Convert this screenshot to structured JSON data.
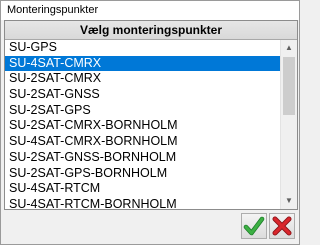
{
  "window": {
    "title": "Monteringspunkter"
  },
  "list": {
    "header": "Vælg monteringspunkter",
    "selected_index": 1,
    "items": [
      "SU-GPS",
      "SU-4SAT-CMRX",
      "SU-2SAT-CMRX",
      "SU-2SAT-GNSS",
      "SU-2SAT-GPS",
      "SU-2SAT-CMRX-BORNHOLM",
      "SU-4SAT-CMRX-BORNHOLM",
      "SU-2SAT-GNSS-BORNHOLM",
      "SU-2SAT-GPS-BORNHOLM",
      "SU-4SAT-RTCM",
      "SU-4SAT-RTCM-BORNHOLM"
    ]
  },
  "buttons": {
    "ok_icon": "green-check-icon",
    "cancel_icon": "red-x-icon",
    "ok_color": "#3cb043",
    "cancel_color": "#d9262c"
  },
  "colors": {
    "selection": "#0078d7"
  }
}
